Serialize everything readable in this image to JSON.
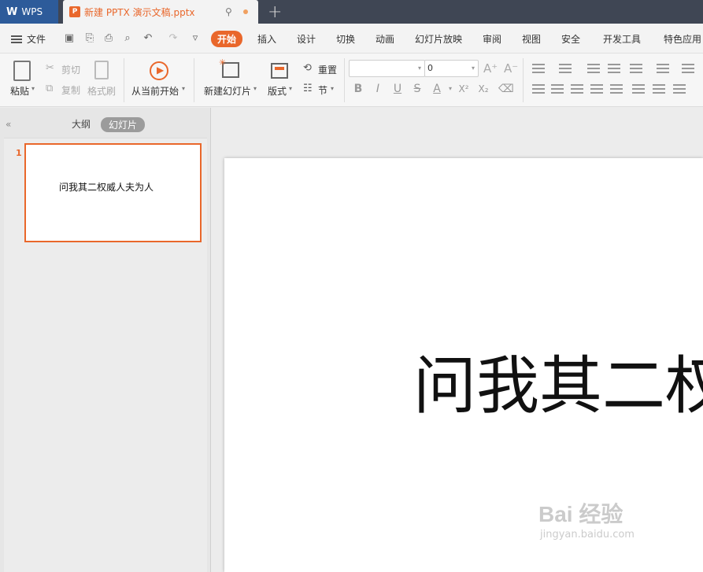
{
  "titlebar": {
    "app_tab": "WPS",
    "app_logo": "W",
    "doc_tab": "新建 PPTX 演示文稿.pptx",
    "doc_icon_letter": "P",
    "new_tab": "+"
  },
  "menubar": {
    "file": "文件",
    "tabs": [
      "开始",
      "插入",
      "设计",
      "切换",
      "动画",
      "幻灯片放映",
      "审阅",
      "视图",
      "安全",
      "开发工具",
      "特色应用"
    ],
    "active_tab": "开始"
  },
  "ribbon": {
    "paste": "粘贴",
    "cut": "剪切",
    "copy": "复制",
    "format_painter": "格式刷",
    "start_from_current": "从当前开始",
    "new_slide": "新建幻灯片",
    "layout": "版式",
    "reset": "重置",
    "section": "节",
    "font_name": "",
    "font_size": "0"
  },
  "leftpanel": {
    "outline_tab": "大纲",
    "slides_tab": "幻灯片",
    "slide_number": "1",
    "thumb_text": "问我其二权威人夫为人"
  },
  "slide": {
    "title": "问我其二权威人夫为人"
  },
  "watermark": {
    "main": "Bai 经验",
    "sub": "jingyan.baidu.com"
  },
  "colors": {
    "accent": "#e9672b",
    "titlebar": "#3f4654",
    "wps_tab": "#2d5b9a"
  }
}
